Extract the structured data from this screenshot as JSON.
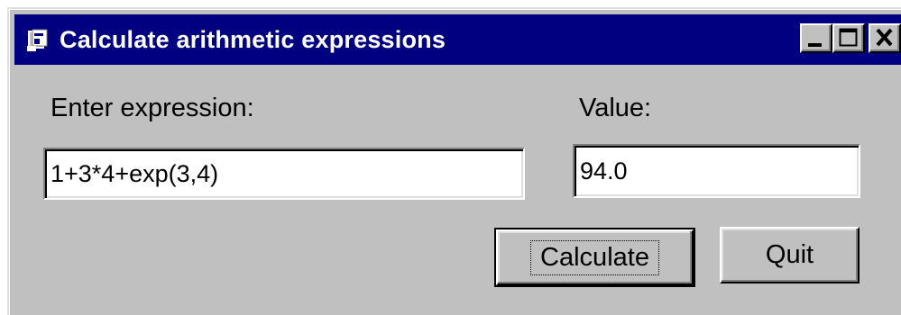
{
  "window": {
    "title": "Calculate arithmetic expressions",
    "icon": "app-window-icon",
    "controls": [
      "minimize-icon",
      "maximize-icon",
      "close-icon"
    ]
  },
  "form": {
    "expression_label": "Enter expression:",
    "expression_value": "1+3*4+exp(3,4)",
    "value_label": "Value:",
    "value_value": "94.0"
  },
  "buttons": {
    "calculate": "Calculate",
    "quit": "Quit"
  },
  "colors": {
    "titlebar": "#000080",
    "face": "#c0c0c0",
    "field": "#ffffff"
  }
}
